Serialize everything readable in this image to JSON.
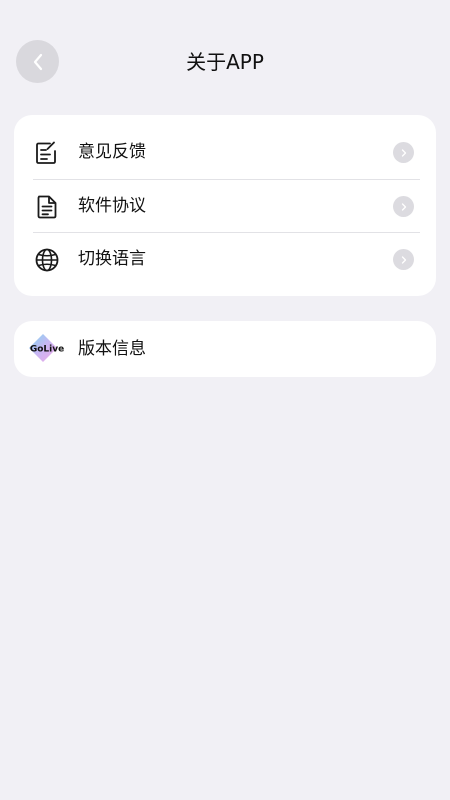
{
  "header": {
    "title": "关于APP",
    "back_icon": "chevron-left-icon"
  },
  "menu": {
    "items": [
      {
        "label": "意见反馈",
        "icon": "feedback-edit-icon"
      },
      {
        "label": "软件协议",
        "icon": "document-icon"
      },
      {
        "label": "切换语言",
        "icon": "globe-icon"
      }
    ]
  },
  "version": {
    "label": "版本信息",
    "logo_text": "GoLive"
  },
  "colors": {
    "background": "#f1f0f5",
    "card": "#ffffff",
    "chevron_circle": "#dcdbe0",
    "back_circle": "#d9d8dd"
  }
}
